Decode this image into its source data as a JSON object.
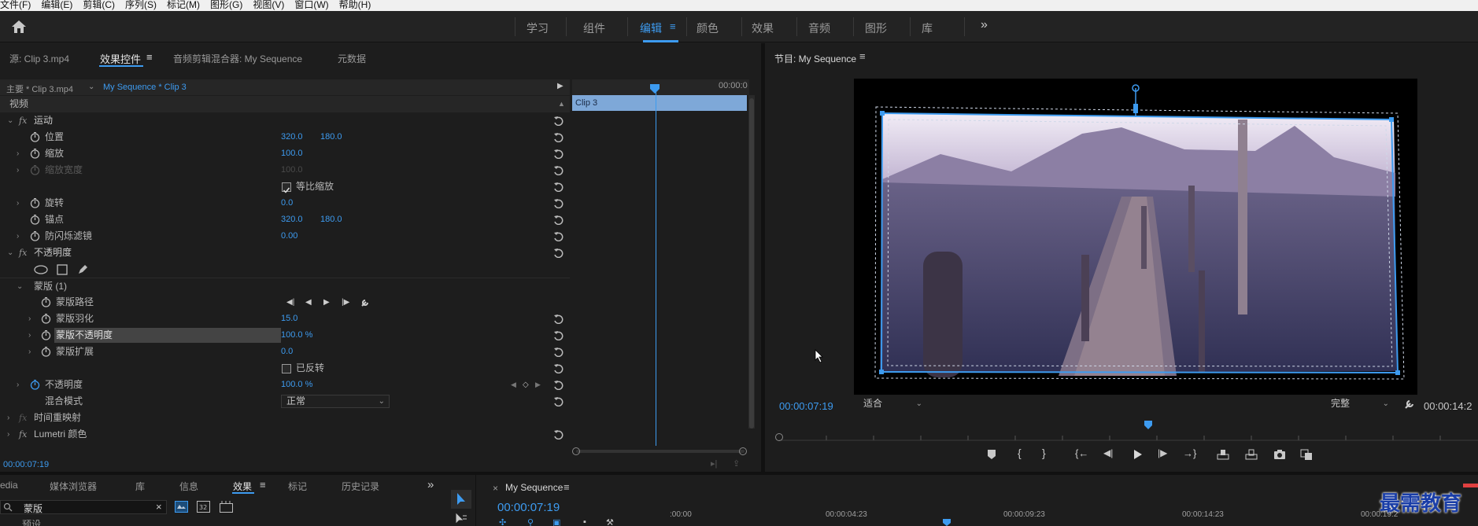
{
  "menu": [
    "文件(F)",
    "编辑(E)",
    "剪辑(C)",
    "序列(S)",
    "标记(M)",
    "图形(G)",
    "视图(V)",
    "窗口(W)",
    "帮助(H)"
  ],
  "workspaces": {
    "tabs": [
      "学习",
      "组件",
      "编辑",
      "颜色",
      "效果",
      "音频",
      "图形",
      "库"
    ],
    "active": "编辑",
    "more": "»"
  },
  "left_panel": {
    "tabs": [
      "源: Clip 3.mp4",
      "效果控件",
      "音频剪辑混合器: My Sequence",
      "元数据"
    ],
    "menu_icon": "≡",
    "source_clip": "主要 * Clip 3.mp4",
    "seq_clip": "My Sequence * Clip 3",
    "timeline_time": "00:00:0",
    "clip_bar": "Clip 3",
    "section_video": "视频",
    "current_time": "00:00:07:19"
  },
  "effects": {
    "motion": "运动",
    "position": {
      "label": "位置",
      "x": "320.0",
      "y": "180.0"
    },
    "scale": {
      "label": "缩放",
      "value": "100.0"
    },
    "scale_width": {
      "label": "缩放宽度",
      "value": "100.0"
    },
    "uniform_scale": "等比缩放",
    "rotation": {
      "label": "旋转",
      "value": "0.0"
    },
    "anchor": {
      "label": "锚点",
      "x": "320.0",
      "y": "180.0"
    },
    "antiflicker": {
      "label": "防闪烁滤镜",
      "value": "0.00"
    },
    "opacity_section": "不透明度",
    "mask": "蒙版 (1)",
    "mask_path": "蒙版路径",
    "mask_feather": {
      "label": "蒙版羽化",
      "value": "15.0"
    },
    "mask_opacity": {
      "label": "蒙版不透明度",
      "value": "100.0 %"
    },
    "mask_expansion": {
      "label": "蒙版扩展",
      "value": "0.0"
    },
    "inverted": "已反转",
    "opacity": {
      "label": "不透明度",
      "value": "100.0 %"
    },
    "blend_mode": {
      "label": "混合模式",
      "value": "正常"
    },
    "time_remap": "时间重映射",
    "lumetri": "Lumetri 颜色"
  },
  "program_monitor": {
    "title": "节目: My Sequence",
    "timecode": "00:00:07:19",
    "fit": "适合",
    "quality": "完整",
    "duration": "00:00:14:2"
  },
  "bottom_left": {
    "tabs": [
      "edia",
      "媒体浏览器",
      "库",
      "信息",
      "效果",
      "标记",
      "历史记录"
    ],
    "active": "效果",
    "search_value": "蒙版",
    "partial_row": "预设"
  },
  "timeline": {
    "title": "My Sequence",
    "timecode": "00:00:07:19",
    "ruler": [
      ":00:00",
      "00:00:04:23",
      "00:00:09:23",
      "00:00:14:23",
      "00:00:19:2"
    ]
  },
  "watermark": "最需教育",
  "colors": {
    "accent": "#3d9bf0",
    "panel": "#1d1d1d",
    "header": "#232323"
  }
}
